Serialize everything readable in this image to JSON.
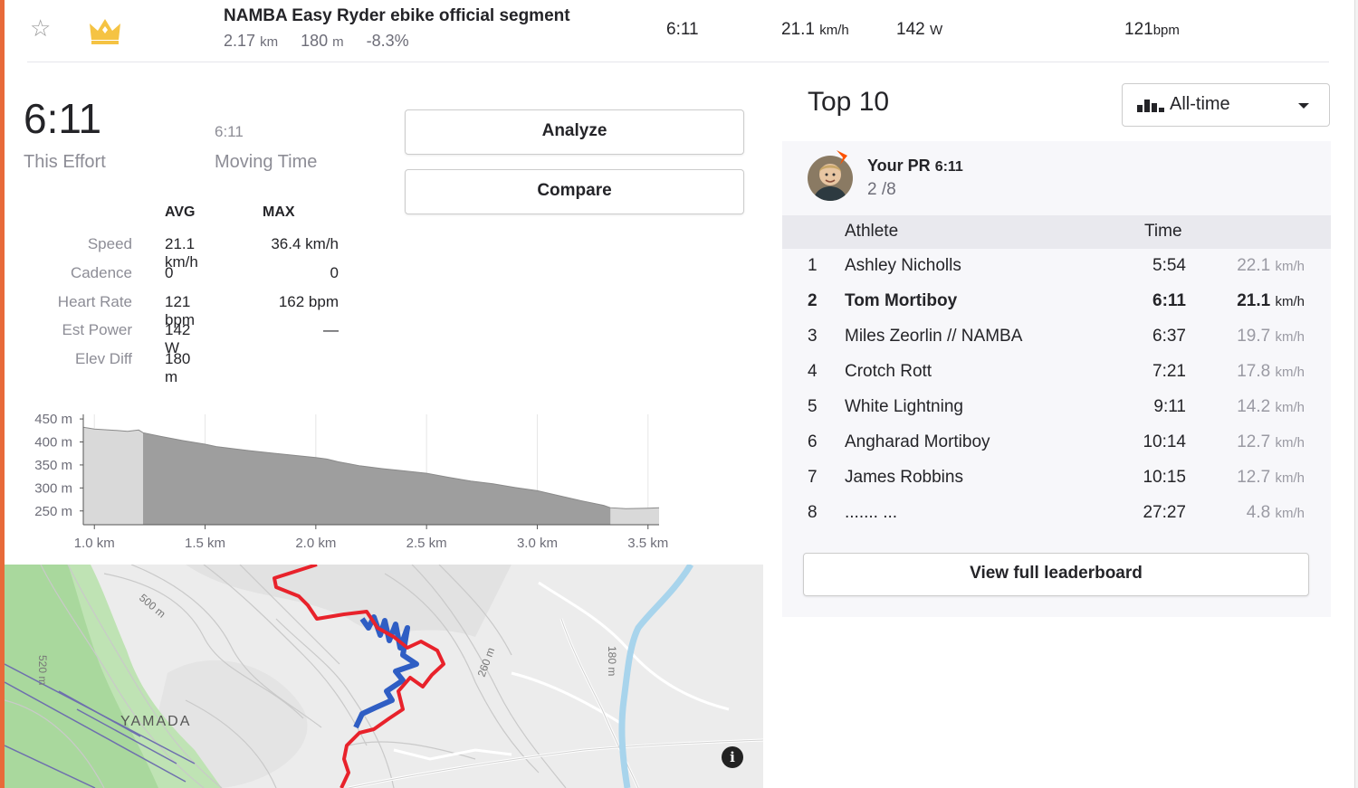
{
  "segment": {
    "name": "NAMBA Easy Ryder ebike official segment",
    "distance_value": "2.17",
    "distance_unit": "km",
    "elev_value": "180",
    "elev_unit": "m",
    "grade": "-8.3%",
    "time": "6:11",
    "speed_value": "21.1",
    "speed_unit": "km/h",
    "power_value": "142",
    "power_unit": "W",
    "hr_value": "121",
    "hr_unit": "bpm"
  },
  "effort": {
    "time": "6:11",
    "time_label": "This Effort",
    "moving_time": "6:11",
    "moving_label": "Moving Time"
  },
  "buttons": {
    "analyze": "Analyze",
    "compare": "Compare",
    "view_full": "View full leaderboard"
  },
  "stats": {
    "avg_header": "AVG",
    "max_header": "MAX",
    "rows": [
      {
        "label": "Speed",
        "avg": "21.1 km/h",
        "max": "36.4 km/h"
      },
      {
        "label": "Cadence",
        "avg": "0",
        "max": "0"
      },
      {
        "label": "Heart Rate",
        "avg": "121 bpm",
        "max": "162 bpm"
      },
      {
        "label": "Est Power",
        "avg": "142 W",
        "max": "—"
      },
      {
        "label": "Elev Diff",
        "avg": "180 m",
        "max": ""
      }
    ]
  },
  "chart_data": {
    "type": "area",
    "xlim": [
      0.95,
      3.55
    ],
    "ylim": [
      220,
      460
    ],
    "x_ticks": [
      "1.0 km",
      "1.5 km",
      "2.0 km",
      "2.5 km",
      "3.0 km",
      "3.5 km"
    ],
    "x_tick_values": [
      1.0,
      1.5,
      2.0,
      2.5,
      3.0,
      3.5
    ],
    "y_ticks": [
      "450 m",
      "400 m",
      "350 m",
      "300 m",
      "250 m"
    ],
    "y_tick_values": [
      450,
      400,
      350,
      300,
      250
    ],
    "segment_range": [
      1.22,
      3.33
    ],
    "profile_x": [
      0.95,
      1.0,
      1.1,
      1.15,
      1.2,
      1.22,
      1.3,
      1.4,
      1.5,
      1.55,
      1.6,
      1.7,
      1.8,
      1.9,
      2.0,
      2.05,
      2.1,
      2.2,
      2.3,
      2.4,
      2.5,
      2.6,
      2.7,
      2.8,
      2.9,
      3.0,
      3.1,
      3.2,
      3.3,
      3.33,
      3.4,
      3.5,
      3.55
    ],
    "profile_y": [
      432,
      428,
      425,
      423,
      426,
      420,
      412,
      403,
      395,
      390,
      387,
      381,
      376,
      371,
      366,
      363,
      357,
      348,
      342,
      337,
      332,
      323,
      315,
      309,
      301,
      294,
      283,
      272,
      262,
      257,
      255,
      256,
      257
    ],
    "grid": true
  },
  "map": {
    "place_label": "YAMADA",
    "contours": [
      "500 m",
      "520 m",
      "260 m",
      "180 m"
    ],
    "info_icon": "i"
  },
  "leaderboard": {
    "title": "Top 10",
    "filter": "All-time",
    "pr_label": "Your PR",
    "pr_time": "6:11",
    "pr_rank": "2 /8",
    "col_athlete": "Athlete",
    "col_time": "Time",
    "rows": [
      {
        "rank": "1",
        "name": "Ashley Nicholls",
        "time": "5:54",
        "speed": "22.1",
        "unit": "km/h"
      },
      {
        "rank": "2",
        "name": "Tom Mortiboy",
        "time": "6:11",
        "speed": "21.1",
        "unit": "km/h"
      },
      {
        "rank": "3",
        "name": "Miles Zeorlin // NAMBA",
        "time": "6:37",
        "speed": "19.7",
        "unit": "km/h"
      },
      {
        "rank": "4",
        "name": "Crotch Rott",
        "time": "7:21",
        "speed": "17.8",
        "unit": "km/h"
      },
      {
        "rank": "5",
        "name": "White Lightning",
        "time": "9:11",
        "speed": "14.2",
        "unit": "km/h"
      },
      {
        "rank": "6",
        "name": "Angharad Mortiboy",
        "time": "10:14",
        "speed": "12.7",
        "unit": "km/h"
      },
      {
        "rank": "7",
        "name": "James Robbins",
        "time": "10:15",
        "speed": "12.7",
        "unit": "km/h"
      },
      {
        "rank": "8",
        "name": "....... ...",
        "time": "27:27",
        "speed": "4.8",
        "unit": "km/h"
      }
    ]
  },
  "colors": {
    "accent": "#e86a3a",
    "crown": "#f5c343",
    "route_red": "#e8222b",
    "route_blue": "#2f5ec4",
    "strava": "#fc5200"
  }
}
